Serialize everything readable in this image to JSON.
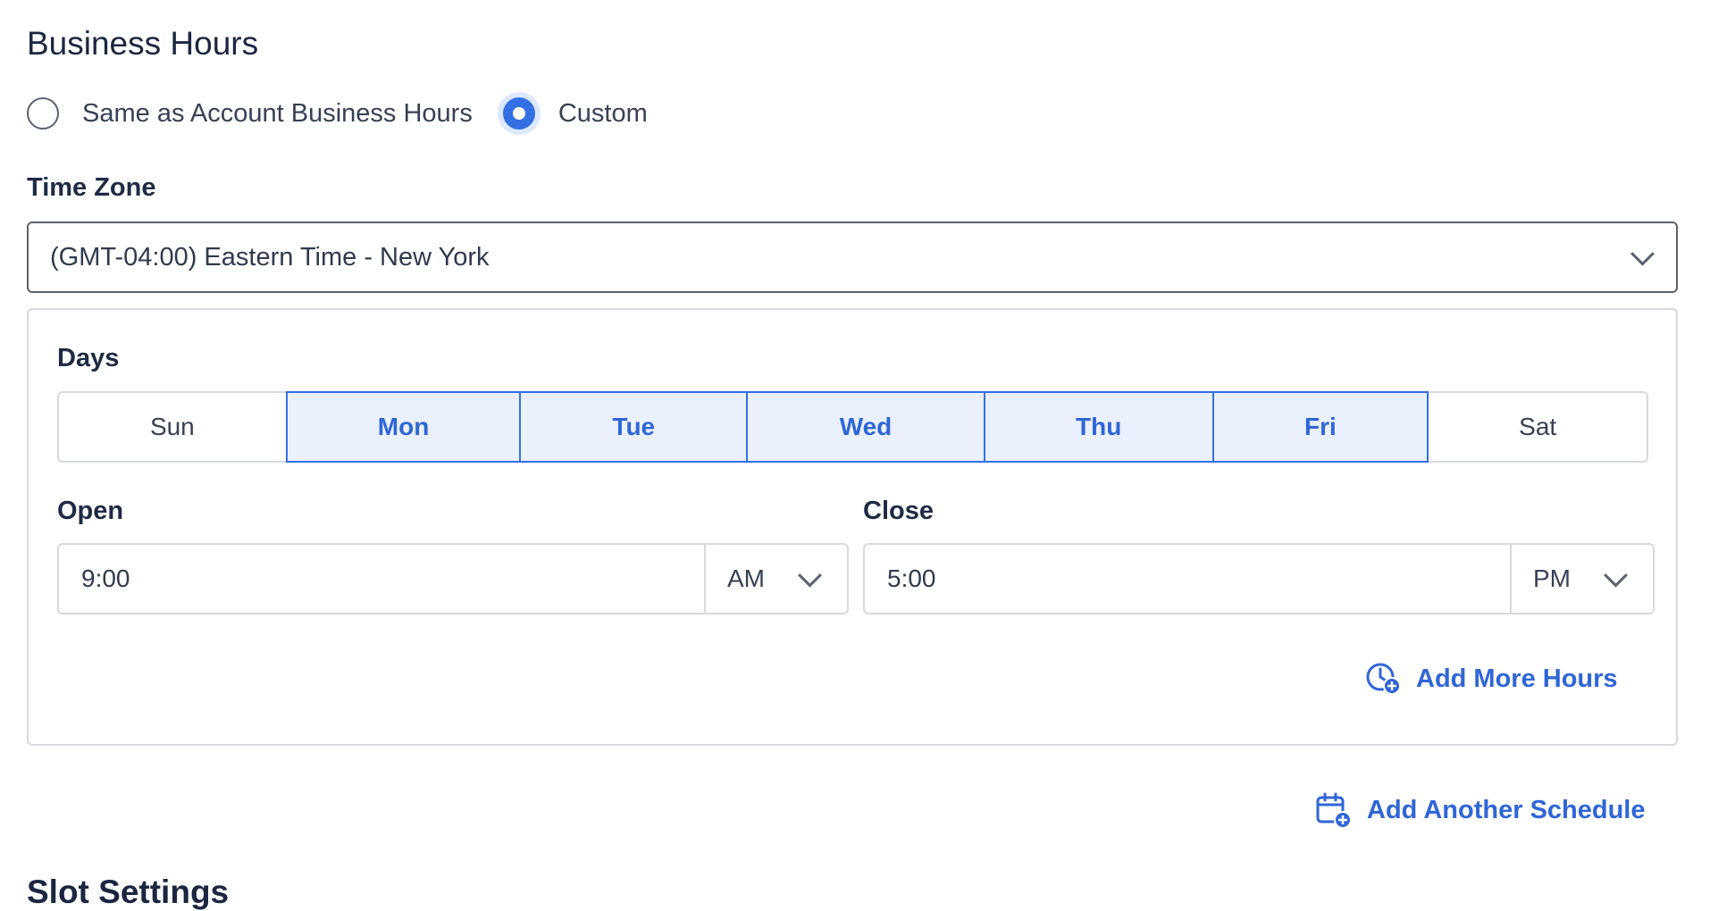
{
  "section": {
    "title": "Business Hours"
  },
  "hours_mode": {
    "options": [
      {
        "label": "Same as Account Business Hours",
        "checked": false
      },
      {
        "label": "Custom",
        "checked": true
      }
    ]
  },
  "timezone": {
    "label": "Time Zone",
    "value": "(GMT-04:00) Eastern Time - New York"
  },
  "schedule": {
    "days_label": "Days",
    "days": [
      {
        "label": "Sun",
        "selected": false
      },
      {
        "label": "Mon",
        "selected": true
      },
      {
        "label": "Tue",
        "selected": true
      },
      {
        "label": "Wed",
        "selected": true
      },
      {
        "label": "Thu",
        "selected": true
      },
      {
        "label": "Fri",
        "selected": true
      },
      {
        "label": "Sat",
        "selected": false
      }
    ],
    "open": {
      "label": "Open",
      "time": "9:00",
      "period": "AM"
    },
    "close": {
      "label": "Close",
      "time": "5:00",
      "period": "PM"
    },
    "add_more_hours": "Add More Hours"
  },
  "add_schedule": "Add Another Schedule",
  "next_section": {
    "title": "Slot Settings"
  },
  "colors": {
    "accent": "#3470e4",
    "accent_bg": "#eaf1fd",
    "border": "#d6d9de"
  }
}
